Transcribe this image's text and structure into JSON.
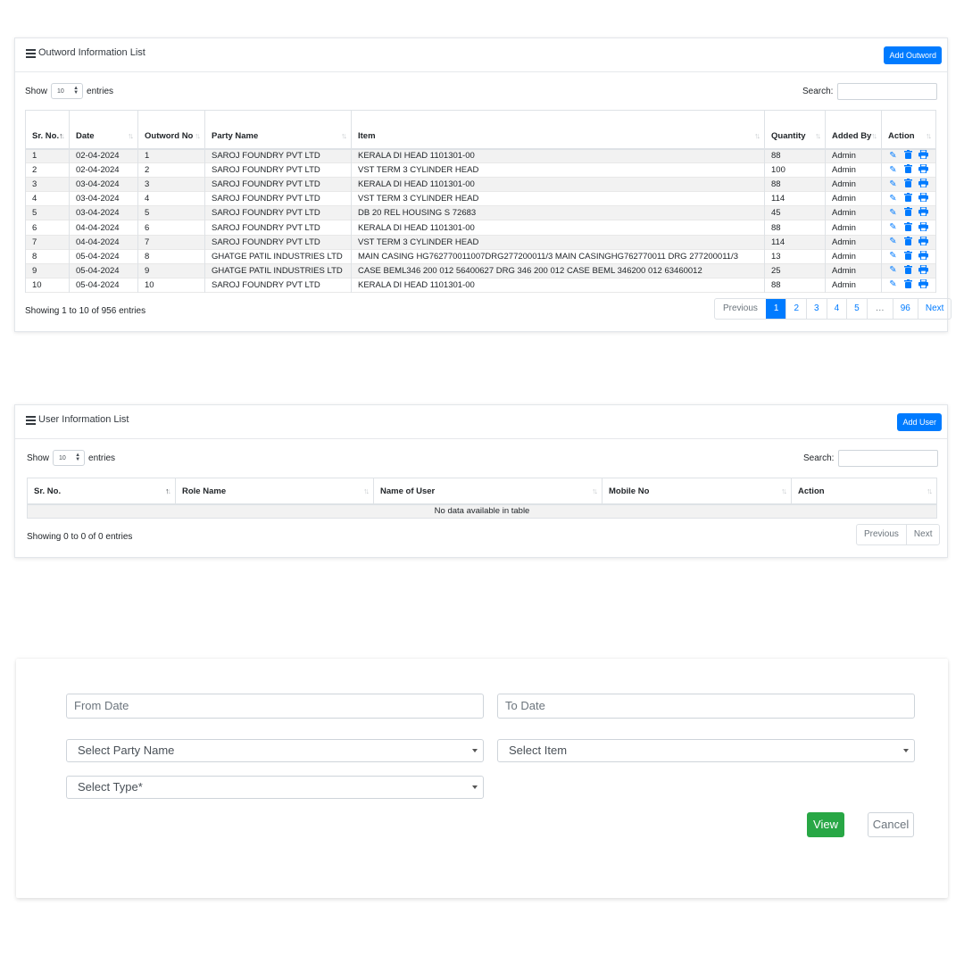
{
  "outward": {
    "title": "Outword Information List",
    "add_button": "Add Outword",
    "show_label": "Show",
    "entries_label": "entries",
    "page_length": "10",
    "search_label": "Search:",
    "columns": [
      "Sr. No.",
      "Date",
      "Outword No",
      "Party Name",
      "Item",
      "Quantity",
      "Added By",
      "Action"
    ],
    "rows": [
      {
        "sr": "1",
        "date": "02-04-2024",
        "no": "1",
        "party": "SAROJ FOUNDRY PVT LTD",
        "item": "KERALA DI HEAD 1101301-00",
        "qty": "88",
        "by": "Admin"
      },
      {
        "sr": "2",
        "date": "02-04-2024",
        "no": "2",
        "party": "SAROJ FOUNDRY PVT LTD",
        "item": "VST TERM 3 CYLINDER HEAD",
        "qty": "100",
        "by": "Admin"
      },
      {
        "sr": "3",
        "date": "03-04-2024",
        "no": "3",
        "party": "SAROJ FOUNDRY PVT LTD",
        "item": "KERALA DI HEAD 1101301-00",
        "qty": "88",
        "by": "Admin"
      },
      {
        "sr": "4",
        "date": "03-04-2024",
        "no": "4",
        "party": "SAROJ FOUNDRY PVT LTD",
        "item": "VST TERM 3 CYLINDER HEAD",
        "qty": "114",
        "by": "Admin"
      },
      {
        "sr": "5",
        "date": "03-04-2024",
        "no": "5",
        "party": "SAROJ FOUNDRY PVT LTD",
        "item": "DB 20 REL HOUSING S 72683",
        "qty": "45",
        "by": "Admin"
      },
      {
        "sr": "6",
        "date": "04-04-2024",
        "no": "6",
        "party": "SAROJ FOUNDRY PVT LTD",
        "item": "KERALA DI HEAD 1101301-00",
        "qty": "88",
        "by": "Admin"
      },
      {
        "sr": "7",
        "date": "04-04-2024",
        "no": "7",
        "party": "SAROJ FOUNDRY PVT LTD",
        "item": "VST TERM 3 CYLINDER HEAD",
        "qty": "114",
        "by": "Admin"
      },
      {
        "sr": "8",
        "date": "05-04-2024",
        "no": "8",
        "party": "GHATGE PATIL INDUSTRIES LTD",
        "item": "MAIN CASING HG762770011007DRG277200011/3 MAIN CASINGHG762770011 DRG 277200011/3",
        "qty": "13",
        "by": "Admin"
      },
      {
        "sr": "9",
        "date": "05-04-2024",
        "no": "9",
        "party": "GHATGE PATIL INDUSTRIES LTD",
        "item": "CASE BEML346 200 012 56400627 DRG 346 200 012 CASE BEML 346200 012 63460012",
        "qty": "25",
        "by": "Admin"
      },
      {
        "sr": "10",
        "date": "05-04-2024",
        "no": "10",
        "party": "SAROJ FOUNDRY PVT LTD",
        "item": "KERALA DI HEAD 1101301-00",
        "qty": "88",
        "by": "Admin"
      }
    ],
    "info": "Showing 1 to 10 of 956 entries",
    "pagination": [
      "Previous",
      "1",
      "2",
      "3",
      "4",
      "5",
      "…",
      "96",
      "Next"
    ]
  },
  "users": {
    "title": "User Information List",
    "add_button": "Add User",
    "show_label": "Show",
    "entries_label": "entries",
    "page_length": "10",
    "search_label": "Search:",
    "columns": [
      "Sr. No.",
      "Role Name",
      "Name of User",
      "Mobile No",
      "Action"
    ],
    "empty_message": "No data available in table",
    "info": "Showing 0 to 0 of 0 entries",
    "pagination": [
      "Previous",
      "Next"
    ]
  },
  "filter": {
    "from_date_placeholder": "From Date",
    "to_date_placeholder": "To Date",
    "party_placeholder": "Select Party Name",
    "item_placeholder": "Select Item",
    "type_placeholder": "Select Type*",
    "view_button": "View",
    "cancel_button": "Cancel"
  },
  "colors": {
    "primary": "#007bff",
    "success": "#28a745"
  },
  "icons": {
    "list": "list-icon",
    "edit": "edit-icon",
    "delete": "trash-icon",
    "print": "print-icon"
  }
}
